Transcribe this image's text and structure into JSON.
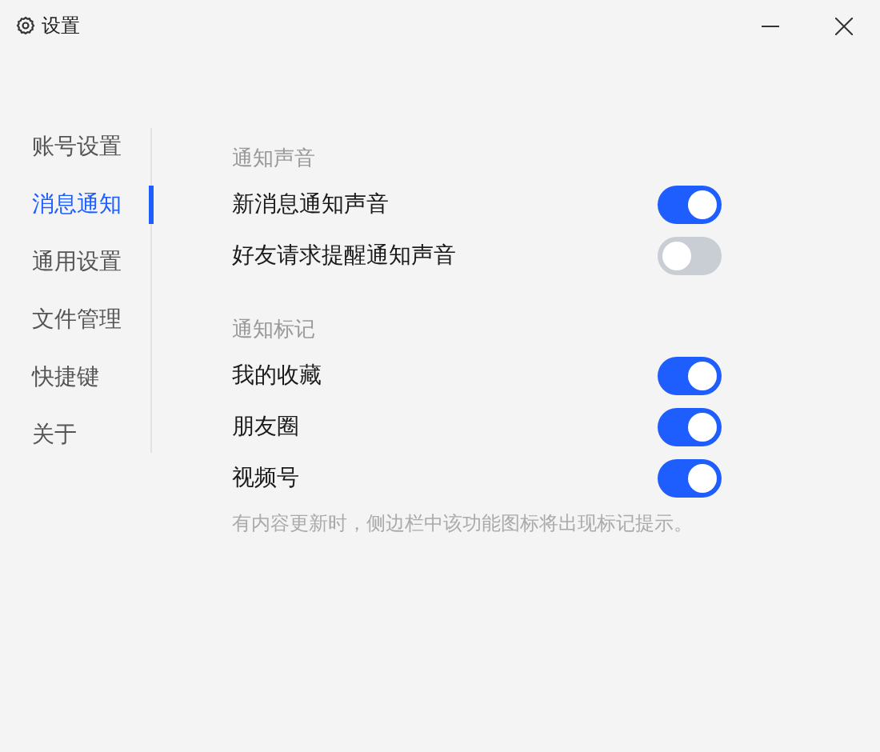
{
  "window": {
    "title": "设置"
  },
  "sidebar": {
    "items": [
      {
        "label": "账号设置",
        "selected": false
      },
      {
        "label": "消息通知",
        "selected": true
      },
      {
        "label": "通用设置",
        "selected": false
      },
      {
        "label": "文件管理",
        "selected": false
      },
      {
        "label": "快捷键",
        "selected": false
      },
      {
        "label": "关于",
        "selected": false
      }
    ]
  },
  "sections": [
    {
      "title": "通知声音",
      "settings": [
        {
          "label": "新消息通知声音",
          "on": true
        },
        {
          "label": "好友请求提醒通知声音",
          "on": false
        }
      ]
    },
    {
      "title": "通知标记",
      "settings": [
        {
          "label": "我的收藏",
          "on": true
        },
        {
          "label": "朋友圈",
          "on": true
        },
        {
          "label": "视频号",
          "on": true
        }
      ],
      "hint": "有内容更新时，侧边栏中该功能图标将出现标记提示。"
    }
  ]
}
